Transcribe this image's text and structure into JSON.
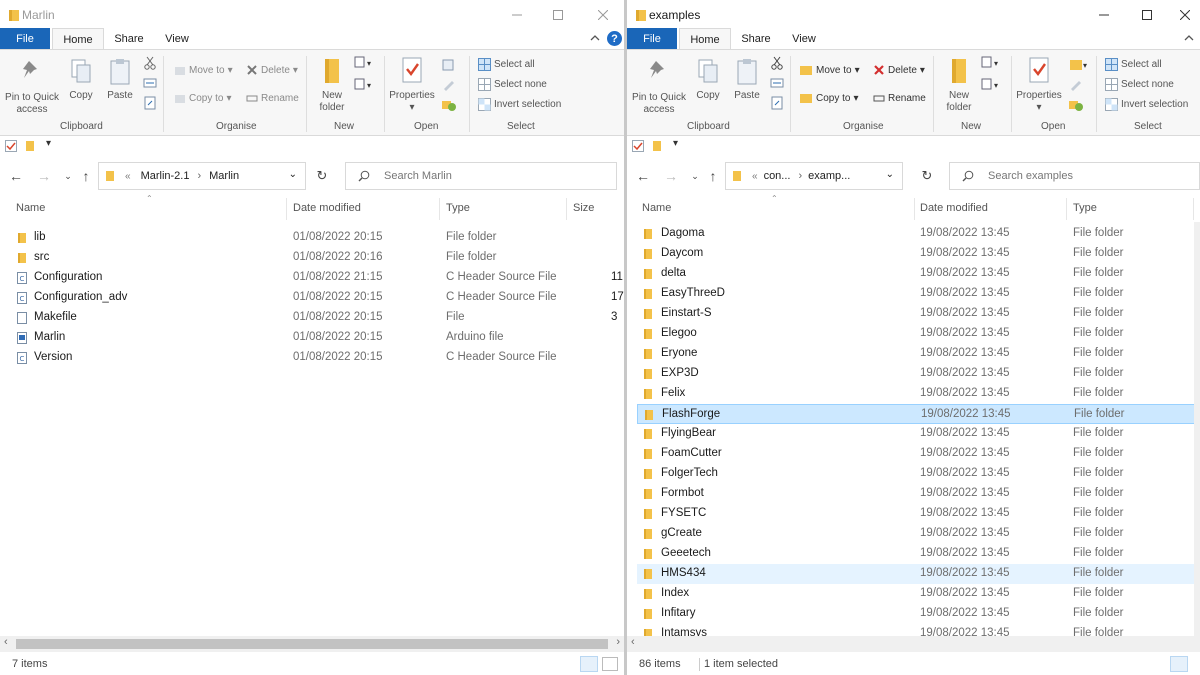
{
  "left": {
    "title": "Marlin",
    "tabs": [
      "File",
      "Home",
      "Share",
      "View"
    ],
    "ribbon": {
      "pin": "Pin to Quick access",
      "copy": "Copy",
      "paste": "Paste",
      "move_to": "Move to",
      "copy_to": "Copy to",
      "delete": "Delete",
      "rename": "Rename",
      "new_folder": "New folder",
      "properties": "Properties",
      "select_all": "Select all",
      "select_none": "Select none",
      "invert_selection": "Invert selection",
      "groups": [
        "Clipboard",
        "Organise",
        "New",
        "Open",
        "Select"
      ]
    },
    "address": {
      "overflow": "«",
      "crumbs": [
        "Marlin-2.1",
        "Marlin"
      ]
    },
    "search_placeholder": "Search Marlin",
    "columns": [
      "Name",
      "Date modified",
      "Type",
      "Size"
    ],
    "files": [
      {
        "name": "lib",
        "date": "01/08/2022 20:15",
        "type": "File folder",
        "size": "",
        "icon": "folder-icon"
      },
      {
        "name": "src",
        "date": "01/08/2022 20:16",
        "type": "File folder",
        "size": "",
        "icon": "folder-icon"
      },
      {
        "name": "Configuration",
        "date": "01/08/2022 21:15",
        "type": "C Header Source File",
        "size": "11",
        "icon": "c-header-file-icon"
      },
      {
        "name": "Configuration_adv",
        "date": "01/08/2022 20:15",
        "type": "C Header Source File",
        "size": "17",
        "icon": "c-header-file-icon"
      },
      {
        "name": "Makefile",
        "date": "01/08/2022 20:15",
        "type": "File",
        "size": "3",
        "icon": "file-icon"
      },
      {
        "name": "Marlin",
        "date": "01/08/2022 20:15",
        "type": "Arduino file",
        "size": "",
        "icon": "arduino-file-icon"
      },
      {
        "name": "Version",
        "date": "01/08/2022 20:15",
        "type": "C Header Source File",
        "size": "",
        "icon": "c-header-file-icon"
      }
    ],
    "status": "7 items"
  },
  "right": {
    "title": "examples",
    "tabs": [
      "File",
      "Home",
      "Share",
      "View"
    ],
    "ribbon": {
      "pin": "Pin to Quick access",
      "copy": "Copy",
      "paste": "Paste",
      "move_to": "Move to",
      "copy_to": "Copy to",
      "delete": "Delete",
      "rename": "Rename",
      "new_folder": "New folder",
      "properties": "Properties",
      "select_all": "Select all",
      "select_none": "Select none",
      "invert_selection": "Invert selection",
      "groups": [
        "Clipboard",
        "Organise",
        "New",
        "Open",
        "Select"
      ]
    },
    "address": {
      "overflow": "«",
      "crumbs": [
        "con...",
        "examp..."
      ]
    },
    "search_placeholder": "Search examples",
    "columns": [
      "Name",
      "Date modified",
      "Type"
    ],
    "files": [
      {
        "name": "Dagoma",
        "date": "19/08/2022 13:45",
        "type": "File folder"
      },
      {
        "name": "Daycom",
        "date": "19/08/2022 13:45",
        "type": "File folder"
      },
      {
        "name": "delta",
        "date": "19/08/2022 13:45",
        "type": "File folder"
      },
      {
        "name": "EasyThreeD",
        "date": "19/08/2022 13:45",
        "type": "File folder"
      },
      {
        "name": "Einstart-S",
        "date": "19/08/2022 13:45",
        "type": "File folder"
      },
      {
        "name": "Elegoo",
        "date": "19/08/2022 13:45",
        "type": "File folder"
      },
      {
        "name": "Eryone",
        "date": "19/08/2022 13:45",
        "type": "File folder"
      },
      {
        "name": "EXP3D",
        "date": "19/08/2022 13:45",
        "type": "File folder"
      },
      {
        "name": "Felix",
        "date": "19/08/2022 13:45",
        "type": "File folder"
      },
      {
        "name": "FlashForge",
        "date": "19/08/2022 13:45",
        "type": "File folder",
        "state": "selected"
      },
      {
        "name": "FlyingBear",
        "date": "19/08/2022 13:45",
        "type": "File folder"
      },
      {
        "name": "FoamCutter",
        "date": "19/08/2022 13:45",
        "type": "File folder"
      },
      {
        "name": "FolgerTech",
        "date": "19/08/2022 13:45",
        "type": "File folder"
      },
      {
        "name": "Formbot",
        "date": "19/08/2022 13:45",
        "type": "File folder"
      },
      {
        "name": "FYSETC",
        "date": "19/08/2022 13:45",
        "type": "File folder"
      },
      {
        "name": "gCreate",
        "date": "19/08/2022 13:45",
        "type": "File folder"
      },
      {
        "name": "Geeetech",
        "date": "19/08/2022 13:45",
        "type": "File folder"
      },
      {
        "name": "HMS434",
        "date": "19/08/2022 13:45",
        "type": "File folder",
        "state": "hover"
      },
      {
        "name": "Index",
        "date": "19/08/2022 13:45",
        "type": "File folder"
      },
      {
        "name": "Infitary",
        "date": "19/08/2022 13:45",
        "type": "File folder"
      },
      {
        "name": "Intamsys",
        "date": "19/08/2022 13:45",
        "type": "File folder"
      }
    ],
    "status_count": "86 items",
    "status_selected": "1 item selected"
  },
  "colors": {
    "file_tab": "#1a66b8",
    "selected_row": "#cce8ff",
    "hover_row": "#e5f3ff",
    "folder": "#f3c24a"
  }
}
